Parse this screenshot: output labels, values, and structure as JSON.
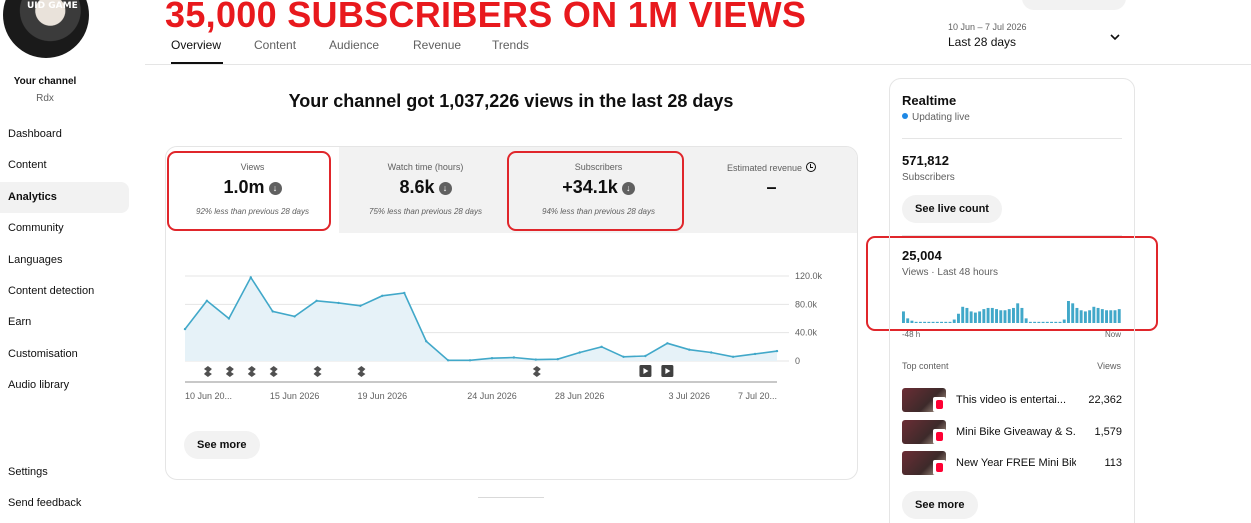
{
  "banner": "35,000 SUBSCRIBERS ON 1M VIEWS",
  "channel": {
    "avatar_text": "UID GAME",
    "label": "Your channel",
    "handle": "Rdx"
  },
  "nav": [
    "Dashboard",
    "Content",
    "Analytics",
    "Community",
    "Languages",
    "Content detection",
    "Earn",
    "Customisation",
    "Audio library"
  ],
  "nav_active": "Analytics",
  "nav_bottom": [
    "Settings",
    "Send feedback"
  ],
  "tabs": [
    "Overview",
    "Content",
    "Audience",
    "Revenue",
    "Trends"
  ],
  "tab_active": "Overview",
  "date_range": "10 Jun – 7 Jul 2026",
  "date_period": "Last 28 days",
  "headline": "Your channel got 1,037,226 views in the last 28 days",
  "metrics": [
    {
      "label": "Views",
      "value": "1.0m",
      "trend": "down",
      "sub": "92% less than previous 28 days",
      "highlighted": true,
      "selected": true
    },
    {
      "label": "Watch time (hours)",
      "value": "8.6k",
      "trend": "down",
      "sub": "75% less than previous 28 days",
      "highlighted": false,
      "selected": false
    },
    {
      "label": "Subscribers",
      "value": "+34.1k",
      "trend": "down",
      "sub": "94% less than previous 28 days",
      "highlighted": true,
      "selected": false
    },
    {
      "label": "Estimated revenue",
      "value": "–",
      "trend": "",
      "sub": "",
      "highlighted": false,
      "selected": false
    }
  ],
  "chart_data": {
    "type": "area",
    "title": "",
    "xlabel": "",
    "ylabel": "",
    "x_tick_labels": [
      "10 Jun 20...",
      "15 Jun 2026",
      "19 Jun 2026",
      "24 Jun 2026",
      "28 Jun 2026",
      "3 Jul 2026",
      "7 Jul 20..."
    ],
    "y_tick_labels": [
      "120.0k",
      "80.0k",
      "40.0k",
      "0"
    ],
    "ylim": [
      0,
      130000
    ],
    "series": [
      {
        "values": [
          45000,
          85000,
          60000,
          118000,
          70000,
          63000,
          85000,
          82000,
          78000,
          92000,
          96000,
          28000,
          1000,
          1000,
          4000,
          5000,
          2000,
          2500,
          12000,
          20000,
          6000,
          7000,
          25000,
          16000,
          12000,
          6000,
          10000,
          14000
        ]
      }
    ],
    "markers": {
      "shorts_days": [
        1,
        2,
        3,
        4,
        6,
        8,
        16
      ],
      "video_days": [
        21,
        22
      ]
    },
    "grid": true,
    "color": "#41a8c9"
  },
  "see_more": "See more",
  "realtime": {
    "title": "Realtime",
    "status": "Updating live",
    "subscribers": "571,812",
    "subscribers_label": "Subscribers",
    "see_live": "See live count",
    "views": "25,004",
    "views_label": "Views · Last 48 hours",
    "axis_left": "-48 h",
    "axis_right": "Now",
    "bars": [
      10,
      4,
      2,
      1,
      1,
      1,
      1,
      1,
      1,
      1,
      1,
      1,
      3,
      8,
      14,
      13,
      10,
      9,
      10,
      12,
      13,
      13,
      12,
      11,
      11,
      12,
      13,
      17,
      13,
      4,
      1,
      1,
      1,
      1,
      1,
      1,
      1,
      1,
      3,
      19,
      17,
      13,
      11,
      10,
      11,
      14,
      13,
      12,
      11,
      11,
      11,
      12
    ],
    "top_content_label": "Top content",
    "views_col_label": "Views",
    "top_content": [
      {
        "title": "This video is entertai...",
        "views": "22,362"
      },
      {
        "title": "Mini Bike Giveaway & S...",
        "views": "1,579"
      },
      {
        "title": "New Year FREE Mini Bike...",
        "views": "113"
      }
    ],
    "see_more": "See more"
  },
  "colors": {
    "highlight": "#e0262b",
    "accent": "#41a8c9",
    "live_dot": "#1e88e5"
  }
}
